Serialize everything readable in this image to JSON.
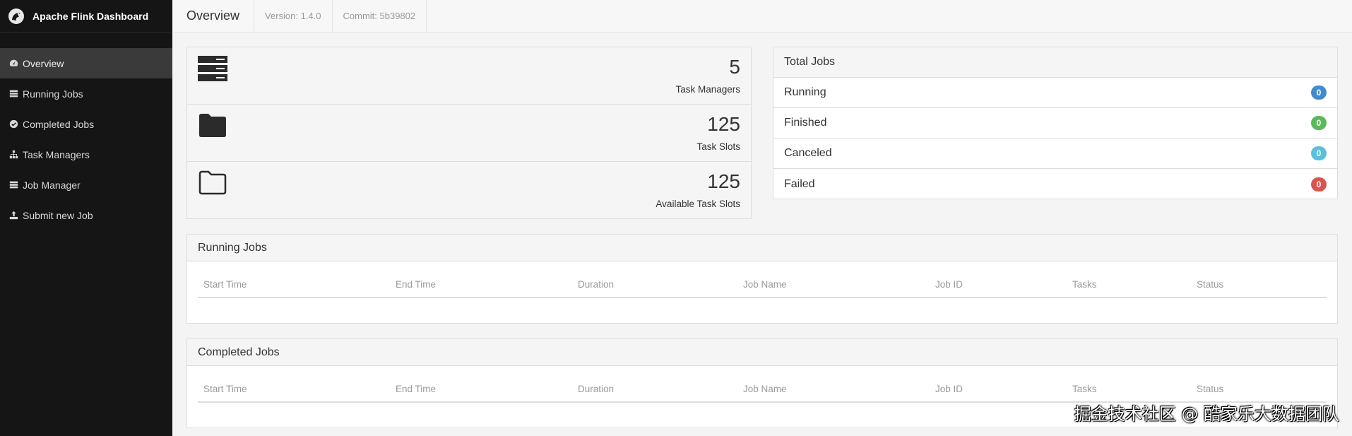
{
  "brand": {
    "title": "Apache Flink Dashboard"
  },
  "sidebar": {
    "items": [
      {
        "label": "Overview",
        "icon": "dashboard-icon",
        "active": true
      },
      {
        "label": "Running Jobs",
        "icon": "list-icon"
      },
      {
        "label": "Completed Jobs",
        "icon": "check-circle-icon"
      },
      {
        "label": "Task Managers",
        "icon": "sitemap-icon"
      },
      {
        "label": "Job Manager",
        "icon": "server-icon"
      },
      {
        "label": "Submit new Job",
        "icon": "upload-icon"
      }
    ]
  },
  "topbar": {
    "title": "Overview",
    "version": "Version: 1.4.0",
    "commit": "Commit: 5b39802"
  },
  "stats": [
    {
      "value": "5",
      "label": "Task Managers",
      "icon": "server-stack-icon"
    },
    {
      "value": "125",
      "label": "Task Slots",
      "icon": "folder-filled-icon"
    },
    {
      "value": "125",
      "label": "Available Task Slots",
      "icon": "folder-open-icon"
    }
  ],
  "total_jobs": {
    "heading": "Total Jobs",
    "rows": [
      {
        "label": "Running",
        "count": "0",
        "color": "#428bca"
      },
      {
        "label": "Finished",
        "count": "0",
        "color": "#5cb85c"
      },
      {
        "label": "Canceled",
        "count": "0",
        "color": "#5bc0de"
      },
      {
        "label": "Failed",
        "count": "0",
        "color": "#d9534f"
      }
    ]
  },
  "running_jobs": {
    "heading": "Running Jobs",
    "columns": [
      "Start Time",
      "End Time",
      "Duration",
      "Job Name",
      "Job ID",
      "Tasks",
      "Status"
    ]
  },
  "completed_jobs": {
    "heading": "Completed Jobs",
    "columns": [
      "Start Time",
      "End Time",
      "Duration",
      "Job Name",
      "Job ID",
      "Tasks",
      "Status"
    ]
  },
  "watermark": "掘金技术社区 @ 酷家乐大数据团队"
}
